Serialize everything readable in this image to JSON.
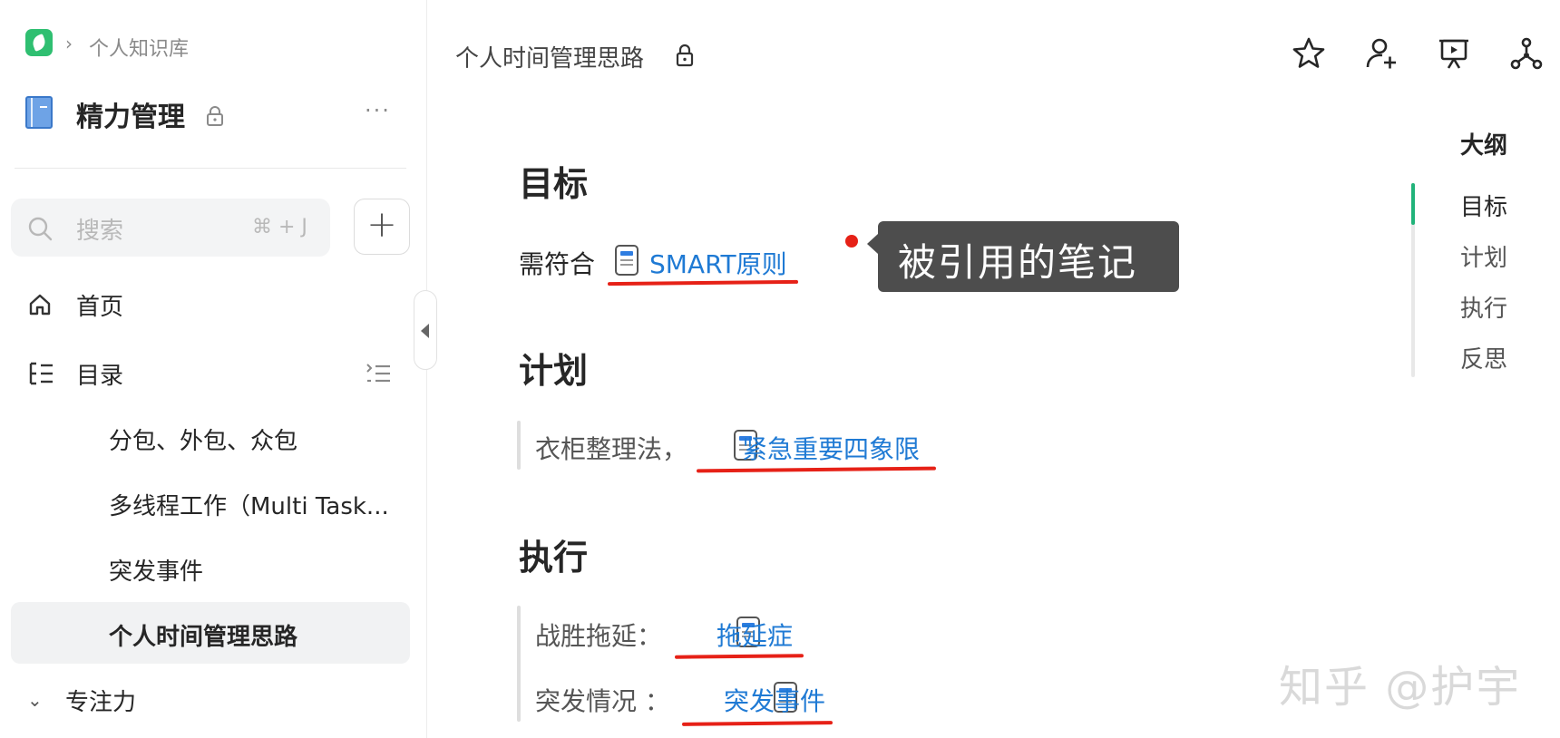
{
  "breadcrumb": {
    "root": "个人知识库"
  },
  "book": {
    "title": "精力管理",
    "more": "···"
  },
  "search": {
    "placeholder": "搜索",
    "shortcut": "⌘ + J"
  },
  "nav": {
    "home": "首页",
    "toc": "目录"
  },
  "toc_items": [
    "分包、外包、众包",
    "多线程工作（Multi Task...",
    "突发事件",
    "个人时间管理思路"
  ],
  "toc_active_index": 3,
  "folder": {
    "label": "专注力",
    "expanded": true
  },
  "header": {
    "doc_title": "个人时间管理思路",
    "icons": [
      "star-icon",
      "add-member-icon",
      "present-icon",
      "graph-icon"
    ]
  },
  "content": {
    "sections": [
      {
        "heading": "目标",
        "text": "需符合",
        "link": "SMART原则"
      },
      {
        "heading": "计划",
        "text": "衣柜整理法，",
        "link": "紧急重要四象限"
      },
      {
        "heading": "执行",
        "lines": [
          {
            "text": "战胜拖延：",
            "link": "拖延症"
          },
          {
            "text": "突发情况 ：",
            "link": "突发事件"
          }
        ]
      }
    ]
  },
  "callout": {
    "text": "被引用的笔记"
  },
  "outline": {
    "title": "大纲",
    "items": [
      "目标",
      "计划",
      "执行",
      "反思"
    ],
    "active_index": 0
  },
  "watermark": "知乎 @护宇",
  "colors": {
    "accent": "#21b37a",
    "link": "#1f7ad4",
    "annotation": "#e62117"
  }
}
